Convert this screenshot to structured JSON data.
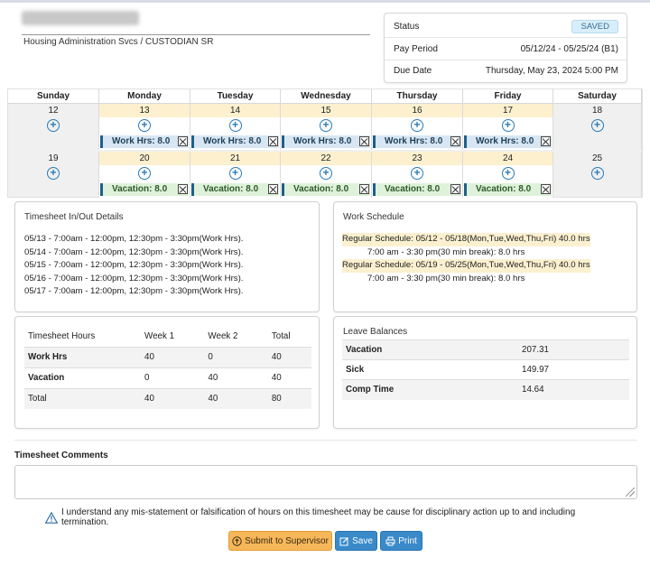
{
  "employee": {
    "department": "Housing Administration Svcs / CUSTODIAN SR"
  },
  "status_panel": {
    "status_label": "Status",
    "status_value": "SAVED",
    "pay_period_label": "Pay Period",
    "pay_period_value": "05/12/24 - 05/25/24 (B1)",
    "due_date_label": "Due Date",
    "due_date_value": "Thursday, May 23, 2024 5:00 PM"
  },
  "calendar": {
    "days": [
      "Sunday",
      "Monday",
      "Tuesday",
      "Wednesday",
      "Thursday",
      "Friday",
      "Saturday"
    ],
    "week1": {
      "dates": [
        "12",
        "13",
        "14",
        "15",
        "16",
        "17",
        "18"
      ],
      "entries": [
        "",
        "Work Hrs: 8.0",
        "Work Hrs: 8.0",
        "Work Hrs: 8.0",
        "Work Hrs: 8.0",
        "Work Hrs: 8.0",
        ""
      ]
    },
    "week2": {
      "dates": [
        "19",
        "20",
        "21",
        "22",
        "23",
        "24",
        "25"
      ],
      "entries": [
        "",
        "Vacation: 8.0",
        "Vacation: 8.0",
        "Vacation: 8.0",
        "Vacation: 8.0",
        "Vacation: 8.0",
        ""
      ]
    }
  },
  "inout": {
    "title": "Timesheet In/Out Details",
    "lines": [
      "05/13 - 7:00am - 12:00pm, 12:30pm - 3:30pm(Work Hrs).",
      "05/14 - 7:00am - 12:00pm, 12:30pm - 3:30pm(Work Hrs).",
      "05/15 - 7:00am - 12:00pm, 12:30pm - 3:30pm(Work Hrs).",
      "05/16 - 7:00am - 12:00pm, 12:30pm - 3:30pm(Work Hrs).",
      "05/17 - 7:00am - 12:00pm, 12:30pm - 3:30pm(Work Hrs)."
    ]
  },
  "work_schedule": {
    "title": "Work Schedule",
    "schedules": [
      {
        "line": "Regular Schedule: 05/12 - 05/18(Mon,Tue,Wed,Thu,Fri) 40.0 hrs",
        "detail": "7:00 am - 3:30 pm(30 min break): 8.0 hrs"
      },
      {
        "line": "Regular Schedule: 05/19 - 05/25(Mon,Tue,Wed,Thu,Fri) 40.0 hrs",
        "detail": "7:00 am - 3:30 pm(30 min break): 8.0 hrs"
      }
    ]
  },
  "timesheet_hours": {
    "title": "Timesheet Hours",
    "columns": [
      "Week 1",
      "Week 2",
      "Total"
    ],
    "rows": [
      {
        "label": "Work Hrs",
        "week1": "40",
        "week2": "0",
        "total": "40"
      },
      {
        "label": "Vacation",
        "week1": "0",
        "week2": "40",
        "total": "40"
      },
      {
        "label": "Total",
        "week1": "40",
        "week2": "40",
        "total": "80"
      }
    ]
  },
  "leave_balances": {
    "title": "Leave Balances",
    "rows": [
      {
        "label": "Vacation",
        "value": "207.31"
      },
      {
        "label": "Sick",
        "value": "149.97"
      },
      {
        "label": "Comp Time",
        "value": "14.64"
      }
    ]
  },
  "comments": {
    "label": "Timesheet Comments",
    "value": ""
  },
  "warning": {
    "text": "I understand any mis-statement or falsification of hours on this timesheet may be cause for disciplinary action up to and including termination."
  },
  "buttons": {
    "submit": "Submit to Supervisor",
    "save": "Save",
    "print": "Print"
  },
  "colors": {
    "accent": "#3a8ac9",
    "submit": "#f6b75a",
    "weekday_header": "#fdf0cf",
    "work_entry": "#d7e6f2",
    "vacation_entry": "#dff1da"
  }
}
